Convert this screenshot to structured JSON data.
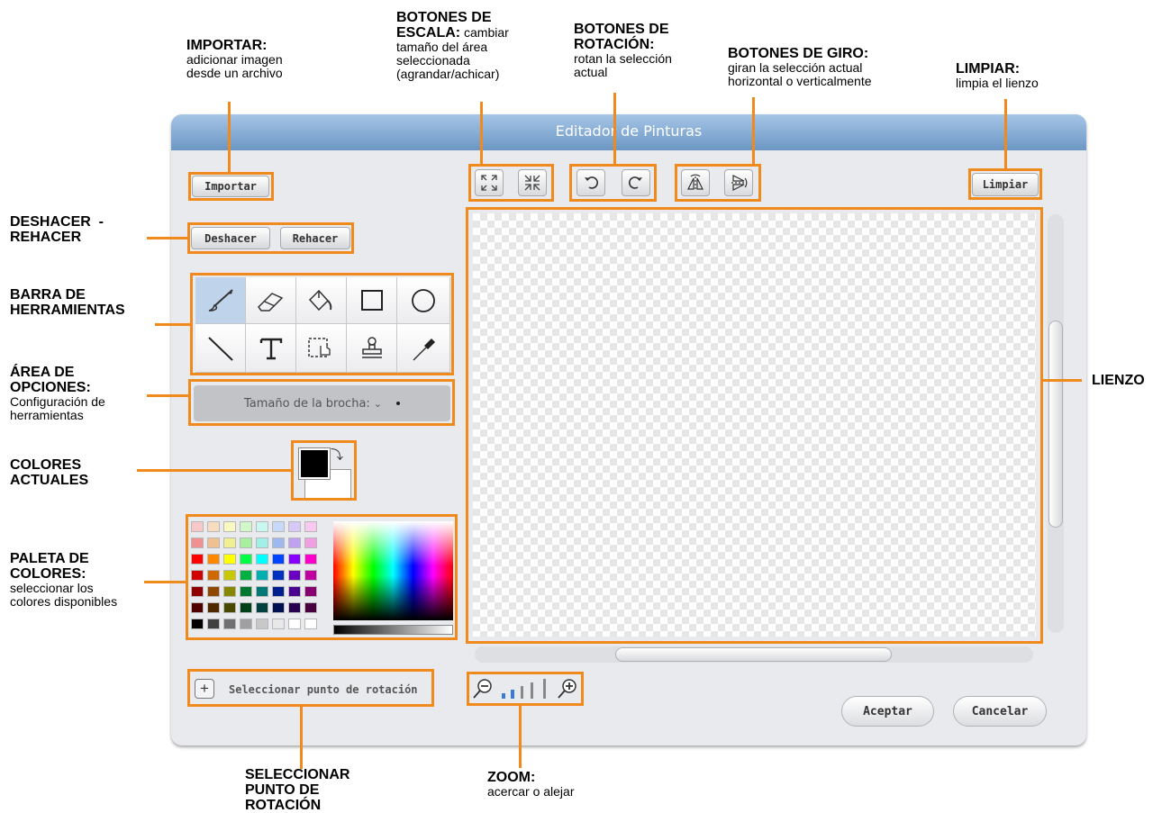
{
  "window": {
    "title": "Editador de Pinturas",
    "buttons": {
      "importar": "Importar",
      "limpiar": "Limpiar",
      "deshacer": "Deshacer",
      "rehacer": "Rehacer",
      "aceptar": "Aceptar",
      "cancelar": "Cancelar"
    },
    "options_label": "Tamaño de la brocha:",
    "rotation_point_label": "Seleccionar punto de rotación",
    "tools": [
      "brush-icon",
      "eraser-icon",
      "fill-icon",
      "rectangle-icon",
      "ellipse-icon",
      "line-icon",
      "text-icon",
      "select-icon",
      "stamp-icon",
      "eyedropper-icon"
    ],
    "current_colors": {
      "foreground": "#000000",
      "background": "#ffffff"
    },
    "palette": [
      [
        "#f8c8c8",
        "#f8dcc0",
        "#f8f8c0",
        "#d0f8c8",
        "#c8f8f0",
        "#c8d8f8",
        "#d8c8f8",
        "#f8c8f0"
      ],
      [
        "#f09090",
        "#f0c090",
        "#f0f090",
        "#a8f0a0",
        "#a0f0e8",
        "#a0b8f0",
        "#c0a0f0",
        "#f0a0e0"
      ],
      [
        "#ff0000",
        "#ff8800",
        "#ffff00",
        "#00ff44",
        "#00ffff",
        "#0044ff",
        "#8800ff",
        "#ff00cc"
      ],
      [
        "#d00000",
        "#d06800",
        "#c8c800",
        "#00b040",
        "#00b0b0",
        "#0030c0",
        "#6a00c0",
        "#c000a0"
      ],
      [
        "#900000",
        "#904800",
        "#888800",
        "#007830",
        "#007878",
        "#002090",
        "#4a0090",
        "#880070"
      ],
      [
        "#500000",
        "#502800",
        "#484800",
        "#004018",
        "#004040",
        "#001050",
        "#280050",
        "#480040"
      ],
      [
        "#000000",
        "#404040",
        "#707070",
        "#a0a0a0",
        "#c8c8c8",
        "#e8e8e8",
        "#ffffff",
        "#ffffff"
      ]
    ]
  },
  "annotations": {
    "importar": {
      "title": "IMPORTAR:",
      "desc": [
        "adicionar imagen",
        "desde un archivo"
      ]
    },
    "escala": {
      "title1": "BOTONES DE",
      "title2": "ESCALA:",
      "inline": " cambiar",
      "desc": [
        "tamaño del área",
        "seleccionada",
        "(agrandar/achicar)"
      ]
    },
    "rotacion": {
      "title1": "BOTONES DE",
      "title2": "ROTACIÓN:",
      "desc": [
        "rotan la selección",
        "actual"
      ]
    },
    "giro": {
      "title": "BOTONES DE GIRO:",
      "desc": [
        "giran la selección actual",
        "horizontal o verticalmente"
      ]
    },
    "limpiar": {
      "title": "LIMPIAR:",
      "desc": [
        "limpia el lienzo"
      ]
    },
    "deshacer": {
      "title1": "DESHACER  -",
      "title2": "REHACER"
    },
    "barra": {
      "title1": "BARRA DE",
      "title2": "HERRAMIENTAS"
    },
    "opciones": {
      "title1": "ÁREA DE",
      "title2": "OPCIONES:",
      "desc": [
        "Configuración de",
        "herramientas"
      ]
    },
    "colores": {
      "title1": "COLORES",
      "title2": "ACTUALES"
    },
    "paleta": {
      "title1": "PALETA DE",
      "title2": "COLORES:",
      "desc": [
        "seleccionar los",
        "colores disponibles"
      ]
    },
    "lienzo": {
      "title": "LIENZO"
    },
    "punto": {
      "title1": "SELECCIONAR",
      "title2": "PUNTO DE",
      "title3": "ROTACIÓN"
    },
    "zoom": {
      "title": "ZOOM:",
      "desc": [
        "acercar o alejar"
      ]
    }
  }
}
